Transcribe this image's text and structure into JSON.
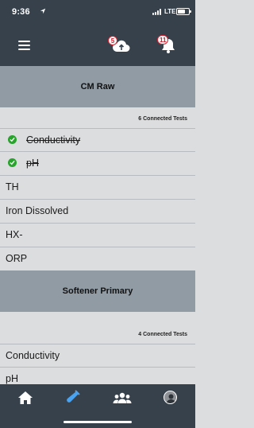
{
  "status_bar": {
    "time": "9:36",
    "network": "LTE",
    "battery_level": 0.7
  },
  "header": {
    "upload_badge": "5",
    "notification_badge": "11"
  },
  "sections": [
    {
      "title": "CM Raw",
      "connected_label": "6 Connected Tests",
      "tests": [
        {
          "label": "Conductivity",
          "completed": true
        },
        {
          "label": "pH",
          "completed": true
        },
        {
          "label": "TH",
          "completed": false
        },
        {
          "label": "Iron Dissolved",
          "completed": false
        },
        {
          "label": "HX-",
          "completed": false
        },
        {
          "label": "ORP",
          "completed": false
        }
      ]
    },
    {
      "title": "Softener Primary",
      "connected_label": "4 Connected Tests",
      "tests": [
        {
          "label": "Conductivity",
          "completed": false
        },
        {
          "label": "pH",
          "completed": false
        }
      ]
    }
  ],
  "tab_bar": {
    "tabs": [
      "home-icon",
      "test-tube-icon",
      "team-icon",
      "profile-icon"
    ],
    "active_color": "#4aa3f0",
    "inactive_color": "#ffffff"
  }
}
